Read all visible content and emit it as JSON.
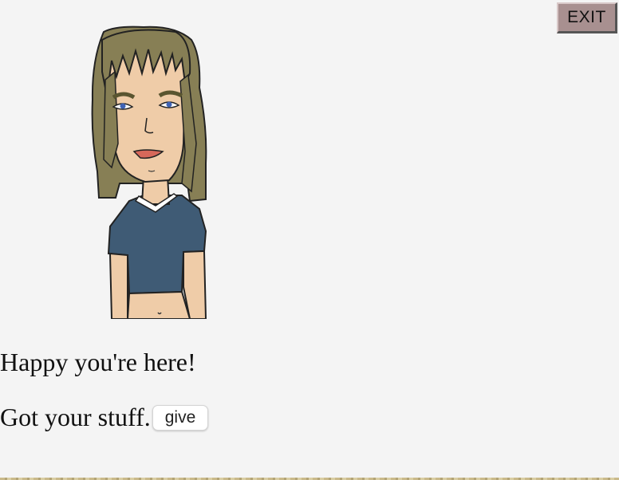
{
  "toolbar": {
    "exit_label": "EXIT"
  },
  "character": {
    "avatar": "cartoon-woman-portrait"
  },
  "dialog": {
    "line1": "Happy you're here!",
    "line2": "Got your stuff.",
    "give_label": "give"
  },
  "colors": {
    "background": "#f4f4f4",
    "exit_button": "#a89090",
    "hair": "#877f55",
    "skin": "#efcca8",
    "shirt": "#3f5b75",
    "lips": "#d6685a",
    "eyes": "#3f63b5"
  }
}
